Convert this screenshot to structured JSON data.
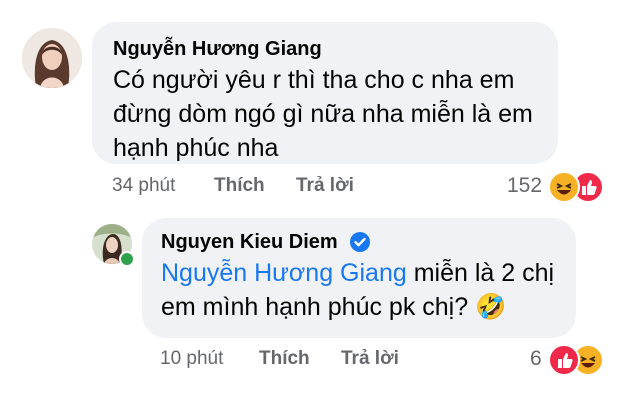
{
  "comment": {
    "author": "Nguyễn Hương Giang",
    "lines": [
      "Có người yêu r thì tha cho c nha em",
      "đừng dòm ngó gì nữa nha miễn là em",
      "hạnh phúc nha"
    ],
    "time": "34 phút",
    "like_label": "Thích",
    "reply_label": "Trả lời",
    "reaction_count": "152",
    "reactions": [
      "haha-icon",
      "like-icon"
    ]
  },
  "reply": {
    "author": "Nguyen Kieu Diem",
    "verified": true,
    "mention": "Nguyễn Hương Giang",
    "line1_rest": " miễn là 2 chị",
    "line2": "em mình hạnh phúc pk chị? ",
    "emoji": "🤣",
    "time": "10 phút",
    "like_label": "Thích",
    "reply_label": "Trả lời",
    "reaction_count": "6",
    "reactions": [
      "like-icon",
      "haha-icon"
    ]
  },
  "colors": {
    "bubble": "#f0f2f5",
    "link": "#1877f2",
    "meta": "#65676b",
    "online": "#31a24c",
    "haha": "#f7b125",
    "like": "#f02849"
  }
}
